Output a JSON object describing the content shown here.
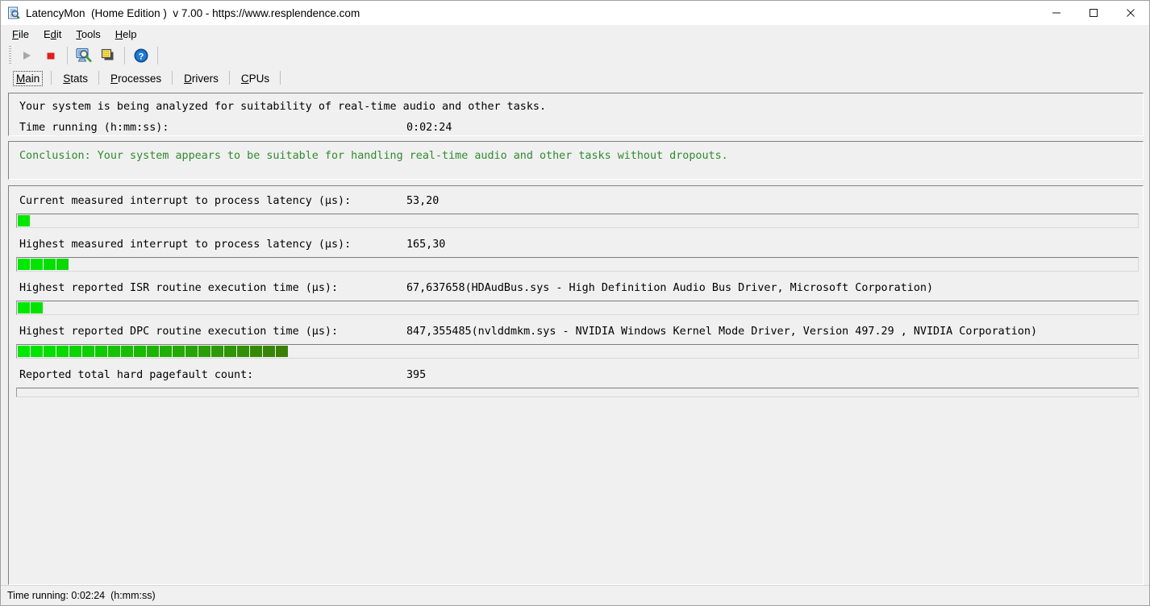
{
  "window": {
    "title": "LatencyMon  (Home Edition )  v 7.00 - https://www.resplendence.com",
    "icon": "latencymon-app-icon",
    "controls": {
      "minimize": "minimize-icon",
      "maximize": "maximize-icon",
      "close": "close-icon"
    }
  },
  "menu": {
    "items": [
      {
        "label": "File",
        "accel": "F",
        "rest": "ile"
      },
      {
        "label": "Edit",
        "accel": "E",
        "rest": "dit"
      },
      {
        "label": "Tools",
        "accel": "T",
        "rest": "ools"
      },
      {
        "label": "Help",
        "accel": "H",
        "rest": "elp"
      }
    ]
  },
  "toolbar": {
    "buttons": [
      {
        "name": "start-button",
        "icon": "play-icon",
        "enabled": false
      },
      {
        "name": "stop-button",
        "icon": "stop-square-icon",
        "enabled": true
      },
      {
        "name": "analyze-button",
        "icon": "monitor-magnifier-icon",
        "enabled": true
      },
      {
        "name": "windows-button",
        "icon": "cascade-windows-icon",
        "enabled": true
      },
      {
        "name": "help-button",
        "icon": "question-circle-icon",
        "enabled": true
      }
    ]
  },
  "tabs": [
    {
      "label": "Main",
      "accel": "M",
      "rest": "ain",
      "selected": true
    },
    {
      "label": "Stats",
      "accel": "S",
      "rest": "tats",
      "selected": false
    },
    {
      "label": "Processes",
      "accel": "P",
      "rest": "rocesses",
      "selected": false
    },
    {
      "label": "Drivers",
      "accel": "D",
      "rest": "rivers",
      "selected": false
    },
    {
      "label": "CPUs",
      "accel": "C",
      "rest": "PUs",
      "selected": false
    }
  ],
  "status_panel": {
    "analysis_line": "Your system is being analyzed for suitability of real-time audio and other tasks.",
    "time_running_label": "Time running (h:mm:ss):",
    "time_running_value": "0:02:24"
  },
  "conclusion": {
    "text": "Conclusion: Your system appears to be suitable for handling real-time audio and other tasks without dropouts.",
    "color": "#2e8b2e"
  },
  "metrics": [
    {
      "name": "current-interrupt-to-process-latency",
      "label": "Current measured interrupt to process latency (µs):",
      "value": "53,20",
      "extra": "",
      "segments": 1,
      "bar_style": "normal"
    },
    {
      "name": "highest-interrupt-to-process-latency",
      "label": "Highest measured interrupt to process latency (µs):",
      "value": "165,30",
      "extra": "",
      "segments": 4,
      "bar_style": "normal"
    },
    {
      "name": "highest-isr-routine-execution-time",
      "label": "Highest reported ISR routine execution time (µs):",
      "value": "67,637658",
      "extra": "(HDAudBus.sys - High Definition Audio Bus Driver, Microsoft Corporation)",
      "segments": 2,
      "bar_style": "normal"
    },
    {
      "name": "highest-dpc-routine-execution-time",
      "label": "Highest reported DPC routine execution time (µs):",
      "value": "847,355485",
      "extra": "(nvlddmkm.sys - NVIDIA Windows Kernel Mode Driver, Version 497.29 , NVIDIA Corporation)",
      "segments": 21,
      "bar_style": "normal"
    },
    {
      "name": "reported-total-hard-pagefault-count",
      "label": "Reported total hard pagefault count:",
      "value": "395",
      "extra": "",
      "segments": 0,
      "bar_style": "thin"
    }
  ],
  "bar_colors": {
    "start": "#00e800",
    "end": "#3a8005"
  },
  "status_bar": {
    "text": "Time running: 0:02:24  (h:mm:ss)"
  }
}
